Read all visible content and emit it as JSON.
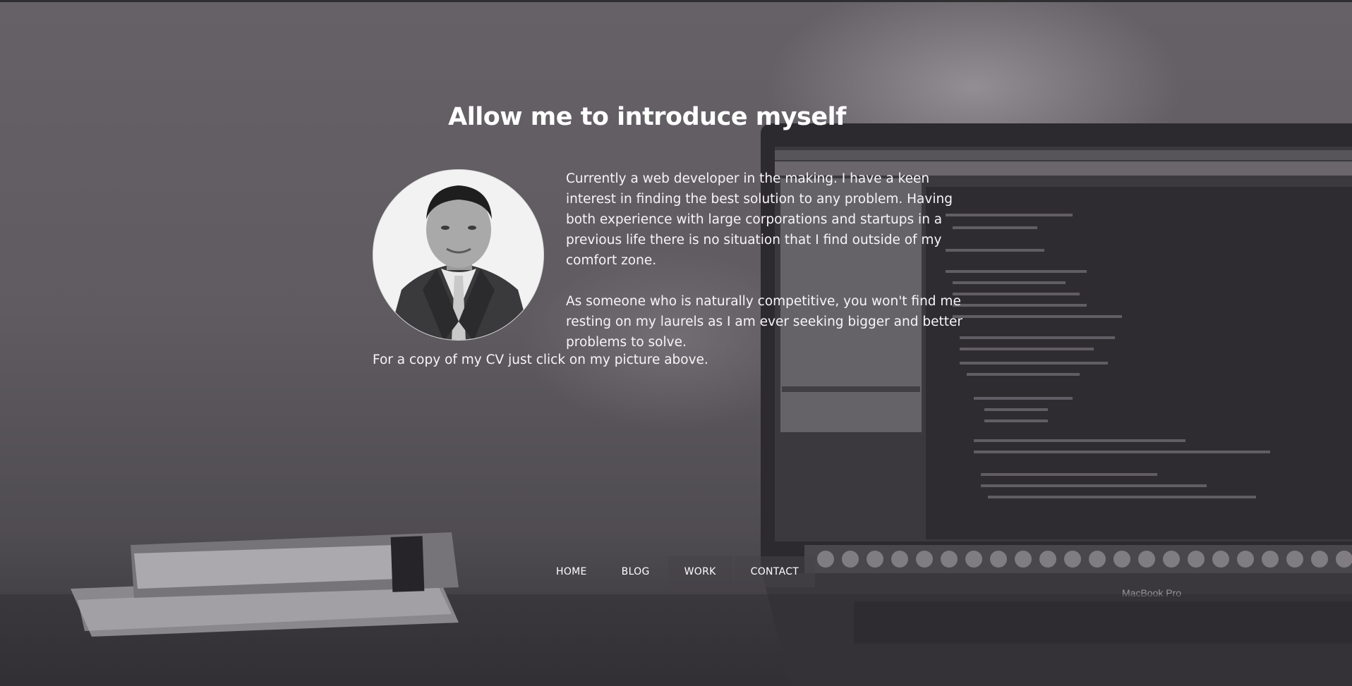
{
  "hero": {
    "title": "Allow me to introduce myself"
  },
  "profile": {
    "photo_alt": "Portrait photo",
    "bio_paragraphs": [
      "Currently a web developer in the making. I have a keen interest in finding the best solution to any problem. Having both experience with large corporations and startups in a previous life there is no situation that I find outside of my comfort zone.",
      "As someone who is naturally competitive, you won't find me resting on my laurels as I am ever seeking bigger and better problems to solve."
    ],
    "cv_note": "For a copy of my CV just click on my picture above."
  },
  "nav": {
    "items": [
      {
        "label": "HOME"
      },
      {
        "label": "BLOG"
      },
      {
        "label": "WORK"
      },
      {
        "label": "CONTACT"
      }
    ]
  },
  "background": {
    "laptop_label": "MacBook Pro"
  },
  "colors": {
    "overlay": "#5b575c",
    "text": "#ffffff"
  }
}
